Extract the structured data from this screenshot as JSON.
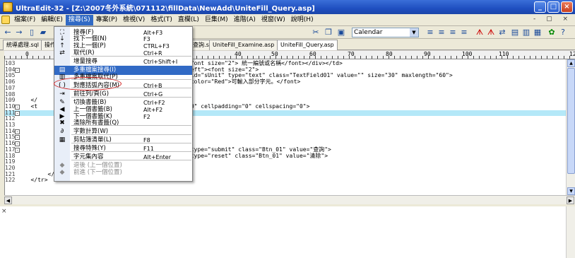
{
  "window": {
    "title": "UltraEdit-32 - [Z:\\2007冬外系統\\071112\\fillData\\NewAdd\\UniteFill_Query.asp]",
    "buttons": [
      "_",
      "□",
      "×"
    ]
  },
  "menubar": {
    "items": [
      "檔案(F)",
      "編輯(E)",
      "搜尋(S)",
      "專案(P)",
      "檢視(V)",
      "格式(T)",
      "直欄(L)",
      "巨集(M)",
      "進階(A)",
      "視窗(W)",
      "說明(H)"
    ],
    "active_index": 2,
    "mdi_controls": "- ▢ ×"
  },
  "toolbar": {
    "combo_value": "Calendar"
  },
  "tabs": {
    "items": [
      "統導處理.sql",
      "操作",
      "台數TOP20資料查詢.sql",
      "UniteFill_Examine.asp",
      "UniteFill_Query.asp"
    ],
    "active_index": 4
  },
  "ruler": {
    "marks": [
      "0",
      "40",
      "50",
      "60",
      "70",
      "80",
      "90",
      "100",
      "110",
      "12"
    ]
  },
  "editor": {
    "lines": [
      {
        "num": "103",
        "fold": "",
        "code": "                                                  font size=\"2\"> 統一編號或名稱</font></div></td>"
      },
      {
        "num": "104",
        "fold": "-",
        "code": "                                                  eft\"><font size=\"2\">"
      },
      {
        "num": "105",
        "fold": "",
        "code": "                                                  id=\"sUnit\" type=\"text\" class=\"TextField01\" value=\"\" size=\"30\" maxlength=\"60\">"
      },
      {
        "num": "106",
        "fold": "",
        "code": "                                                  color=\"Red\">可輸入部分字元。</font>"
      },
      {
        "num": "107",
        "fold": "",
        "code": ""
      },
      {
        "num": "108",
        "fold": "",
        "code": ""
      },
      {
        "num": "109",
        "fold": "",
        "code": "   </"
      },
      {
        "num": "110",
        "fold": "-",
        "code": "   <t                                             0\" cellpadding=\"0\" cellspacing=\"0\">"
      },
      {
        "num": "111",
        "fold": "-",
        "code": ""
      },
      {
        "num": "112",
        "fold": "",
        "code": ""
      },
      {
        "num": "113",
        "fold": "",
        "code": ""
      },
      {
        "num": "114",
        "fold": "-",
        "code": ""
      },
      {
        "num": "115",
        "fold": "-",
        "code": ""
      },
      {
        "num": "116",
        "fold": "-",
        "code": ""
      },
      {
        "num": "117",
        "fold": "-",
        "code": "                                                  type=\"submit\" class=\"Btn_01\" value=\"查詢\">"
      },
      {
        "num": "118",
        "fold": "",
        "code": "                                                  type=\"reset\" class=\"Btn_01\" value=\"清除\">"
      },
      {
        "num": "119",
        "fold": "",
        "code": ""
      },
      {
        "num": "120",
        "fold": "",
        "code": ""
      },
      {
        "num": "121",
        "fold": "",
        "code": "        </ta"
      },
      {
        "num": "122",
        "fold": "",
        "code": "   </tr>"
      }
    ],
    "highlighted_line_index": 8
  },
  "search_menu": {
    "items": [
      {
        "icon": "find-icon",
        "glyph": "⛶",
        "label": "搜尋(F)",
        "shortcut": "Alt+F3",
        "state": "normal"
      },
      {
        "icon": "find-next-icon",
        "glyph": "↓",
        "label": "找下一個(N)",
        "shortcut": "F3",
        "state": "normal"
      },
      {
        "icon": "find-prev-icon",
        "glyph": "↑",
        "label": "找上一個(P)",
        "shortcut": "CTRL+F3",
        "state": "normal"
      },
      {
        "icon": "replace-icon",
        "glyph": "⇄",
        "label": "取代(R)",
        "shortcut": "Ctrl+R",
        "state": "normal"
      },
      {
        "icon": "",
        "glyph": "",
        "label": "增量搜尋",
        "shortcut": "Ctrl+Shift+I",
        "state": "normal"
      },
      {
        "icon": "find-in-files-icon",
        "glyph": "▤",
        "label": "多重檔案搜尋(I)",
        "shortcut": "",
        "state": "selected"
      },
      {
        "icon": "replace-in-files-icon",
        "glyph": "▥",
        "label": "多重檔案取代(P)",
        "shortcut": "",
        "state": "normal"
      },
      {
        "icon": "match-brace-icon",
        "glyph": "( )",
        "label": "對應括弧內容(M)",
        "shortcut": "Ctrl+B",
        "state": "normal"
      },
      {
        "icon": "goto-line-icon",
        "glyph": "⇥",
        "label": "前往列/頁(G)",
        "shortcut": "Ctrl+G",
        "state": "normal"
      },
      {
        "icon": "toggle-bookmark-icon",
        "glyph": "✎",
        "label": "切換書籤(B)",
        "shortcut": "Ctrl+F2",
        "state": "normal"
      },
      {
        "icon": "prev-bookmark-icon",
        "glyph": "◀",
        "label": "上一個書籤(B)",
        "shortcut": "Alt+F2",
        "state": "normal"
      },
      {
        "icon": "next-bookmark-icon",
        "glyph": "▶",
        "label": "下一個書籤(K)",
        "shortcut": "F2",
        "state": "normal"
      },
      {
        "icon": "clear-bookmarks-icon",
        "glyph": "✖",
        "label": "清除所有書籤(Q)",
        "shortcut": "",
        "state": "normal"
      },
      {
        "icon": "word-count-icon",
        "glyph": "∂",
        "label": "字數計算(W)",
        "shortcut": "",
        "state": "normal"
      },
      {
        "icon": "clipboard-icon",
        "glyph": "▦",
        "label": "剪貼簿清單(L)",
        "shortcut": "F8",
        "state": "normal"
      },
      {
        "icon": "",
        "glyph": "",
        "label": "搜尋特殊(Y)",
        "shortcut": "F11",
        "state": "normal"
      },
      {
        "icon": "",
        "glyph": "",
        "label": "字元集內容",
        "shortcut": "Alt+Enter",
        "state": "normal"
      },
      {
        "icon": "back-icon",
        "glyph": "◆",
        "label": "退後 (上一個位置)",
        "shortcut": "",
        "state": "disabled"
      },
      {
        "icon": "forward-icon",
        "glyph": "◆",
        "label": "前進 (下一個位置)",
        "shortcut": "",
        "state": "disabled"
      }
    ]
  },
  "colors": {
    "menu_highlight": "#316ac5",
    "current_line": "#b4e8f8",
    "annotation": "#d02020"
  }
}
